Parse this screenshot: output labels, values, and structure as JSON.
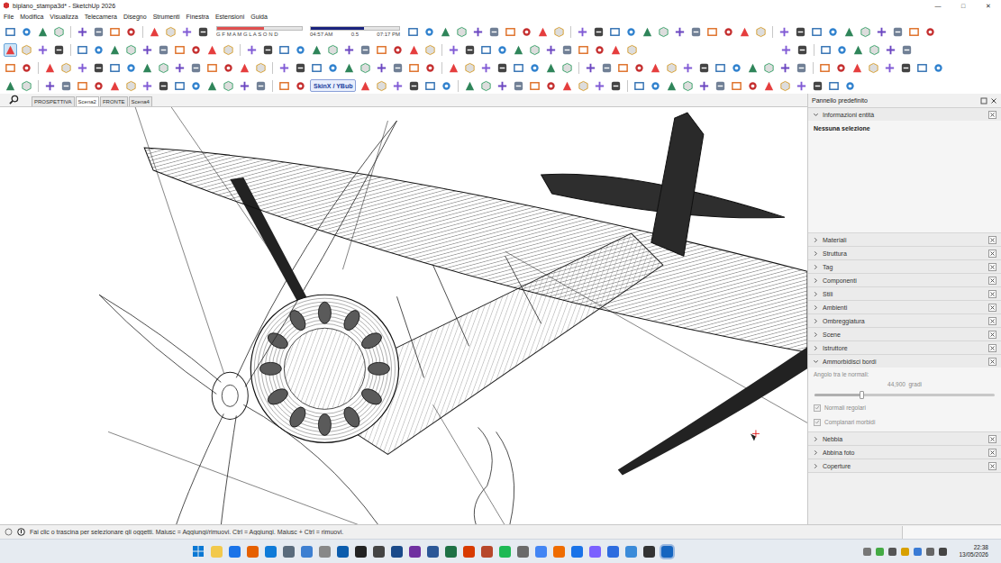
{
  "window": {
    "title": "biplano_stampa3d* - SketchUp 2026",
    "controls": [
      "—",
      "□",
      "✕"
    ]
  },
  "menu": [
    "File",
    "Modifica",
    "Visualizza",
    "Telecamera",
    "Disegno",
    "Strumenti",
    "Finestra",
    "Estensioni",
    "Guida"
  ],
  "shadow_widget": {
    "months": "G F M A M G L A S O N D",
    "time_start": "04:57 AM",
    "mid": "0.5",
    "time_end": "07:17 PM",
    "month_level": 0.55,
    "time_level": 0.6
  },
  "select_tool": {
    "selected": true
  },
  "plugin_button": "SkinX / YBub",
  "scene_tabs": [
    {
      "label": "PROSPETTIVA",
      "selected": false
    },
    {
      "label": "Scena2",
      "selected": true
    },
    {
      "label": "FRONTE",
      "selected": false
    },
    {
      "label": "Scena4",
      "selected": false
    }
  ],
  "panel": {
    "title": "Pannello predefinito",
    "sections": [
      {
        "label": "Informazioni entità",
        "expanded": true,
        "kind": "entity",
        "body": "Nessuna selezione"
      },
      {
        "label": "Materiali",
        "expanded": false,
        "kind": "plain"
      },
      {
        "label": "Struttura",
        "expanded": false,
        "kind": "plain"
      },
      {
        "label": "Tag",
        "expanded": false,
        "kind": "plain"
      },
      {
        "label": "Componenti",
        "expanded": false,
        "kind": "plain"
      },
      {
        "label": "Stili",
        "expanded": false,
        "kind": "plain"
      },
      {
        "label": "Ambienti",
        "expanded": false,
        "kind": "plain"
      },
      {
        "label": "Ombreggiatura",
        "expanded": false,
        "kind": "plain"
      },
      {
        "label": "Scene",
        "expanded": false,
        "kind": "plain"
      },
      {
        "label": "Istruttore",
        "expanded": false,
        "kind": "plain"
      },
      {
        "label": "Ammorbidisci bordi",
        "expanded": true,
        "kind": "softedges",
        "angle_label": "Angolo tra le normali:",
        "angle_value": "44,900  gradi",
        "level": 0.26,
        "options": [
          {
            "label": "Normali regolari",
            "checked": true,
            "disabled": true
          },
          {
            "label": "Complanari morbidi",
            "checked": true,
            "disabled": true
          }
        ]
      },
      {
        "label": "Nebbia",
        "expanded": false,
        "kind": "plain"
      },
      {
        "label": "Abbina foto",
        "expanded": false,
        "kind": "plain"
      },
      {
        "label": "Coperture",
        "expanded": false,
        "kind": "plain"
      }
    ]
  },
  "status_bar": {
    "text": "Fai clic o trascina per selezionare gli oggetti. Maiusc = Aggiungi/rimuovi. Ctrl = Aggiungi. Maiusc + Ctrl = rimuovi."
  },
  "taskbar": {
    "time": "22:38",
    "date": "13/05/2026"
  }
}
